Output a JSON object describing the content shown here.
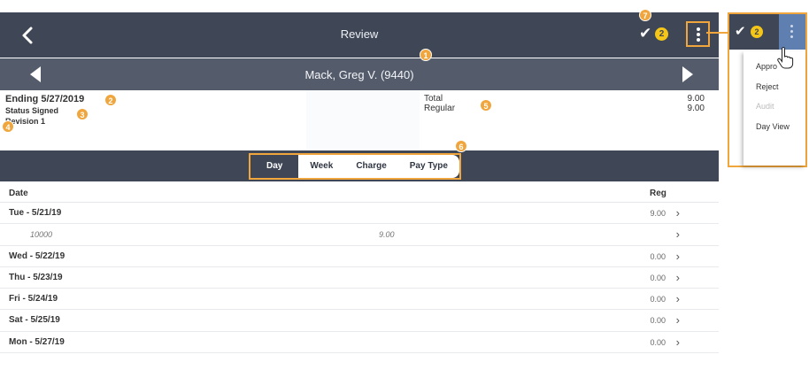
{
  "header": {
    "title": "Review",
    "approve_count": "2"
  },
  "employee": {
    "name": "Mack, Greg V. (9440)"
  },
  "summary": {
    "ending": "Ending 5/27/2019",
    "status": "Status Signed",
    "revision": "Revision 1",
    "total_label": "Total",
    "regular_label": "Regular",
    "total_value": "9.00",
    "regular_value": "9.00"
  },
  "tabs": [
    {
      "label": "Day"
    },
    {
      "label": "Week"
    },
    {
      "label": "Charge"
    },
    {
      "label": "Pay Type"
    }
  ],
  "table": {
    "columns": {
      "date": "Date",
      "reg": "Reg"
    },
    "rows": [
      {
        "date": "Tue - 5/21/19",
        "reg": "9.00"
      },
      {
        "code": "10000",
        "sub_value": "9.00"
      },
      {
        "date": "Wed - 5/22/19",
        "reg": "0.00"
      },
      {
        "date": "Thu - 5/23/19",
        "reg": "0.00"
      },
      {
        "date": "Fri - 5/24/19",
        "reg": "0.00"
      },
      {
        "date": "Sat - 5/25/19",
        "reg": "0.00"
      },
      {
        "date": "Mon - 5/27/19",
        "reg": "0.00"
      }
    ]
  },
  "popup": {
    "approve_count": "2",
    "menu": [
      {
        "label": "Appro"
      },
      {
        "label": "Reject"
      },
      {
        "label": "Audit"
      },
      {
        "label": "Day View"
      }
    ]
  },
  "callouts": [
    "1",
    "2",
    "3",
    "4",
    "5",
    "6",
    "7"
  ],
  "colors": {
    "header": "#3f4757",
    "subheader": "#545c6b",
    "accent": "#f0a63c",
    "badge": "#f5c518"
  }
}
